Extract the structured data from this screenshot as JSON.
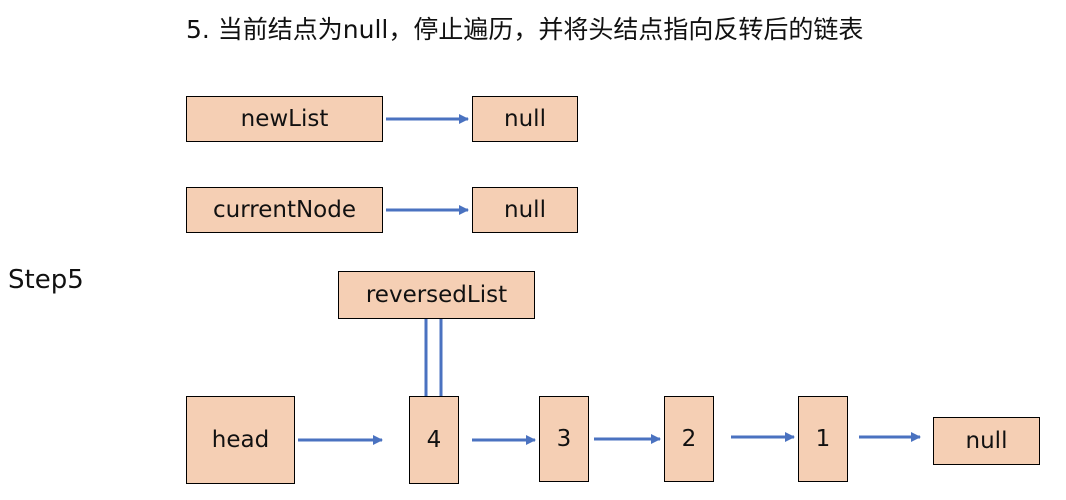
{
  "title": "5. 当前结点为null，停止遍历，并将头结点指向反转后的链表",
  "step_label": "Step5",
  "colors": {
    "node_fill": "#f5cfb4",
    "arrow": "#4a72c0",
    "border": "#000000"
  },
  "nodes": {
    "new_list": "newList",
    "new_list_target": "null",
    "current_node": "currentNode",
    "current_node_target": "null",
    "reversed_list": "reversedList",
    "head": "head",
    "chain": [
      "4",
      "3",
      "2",
      "1",
      "null"
    ]
  }
}
